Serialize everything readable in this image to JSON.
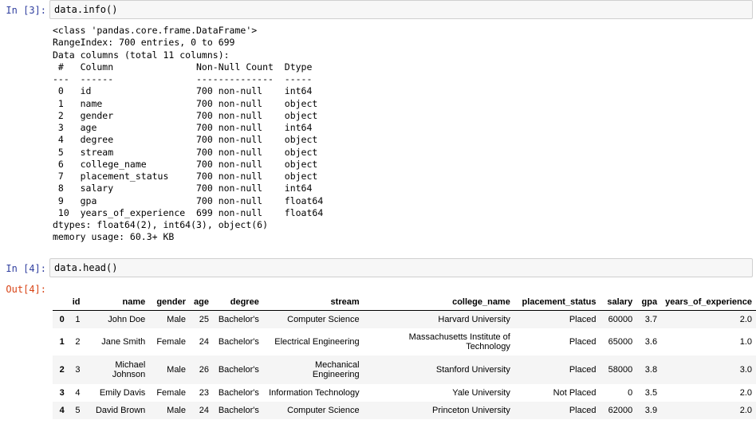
{
  "cells": [
    {
      "prompt": "In [3]:",
      "code": "data.info()"
    },
    {
      "prompt": "In [4]:",
      "code": "data.head()",
      "out_prompt": "Out[4]:"
    }
  ],
  "info_output": "<class 'pandas.core.frame.DataFrame'>\nRangeIndex: 700 entries, 0 to 699\nData columns (total 11 columns):\n #   Column               Non-Null Count  Dtype  \n---  ------               --------------  -----  \n 0   id                   700 non-null    int64  \n 1   name                 700 non-null    object \n 2   gender               700 non-null    object \n 3   age                  700 non-null    int64  \n 4   degree               700 non-null    object \n 5   stream               700 non-null    object \n 6   college_name         700 non-null    object \n 7   placement_status     700 non-null    object \n 8   salary               700 non-null    int64  \n 9   gpa                  700 non-null    float64\n 10  years_of_experience  699 non-null    float64\ndtypes: float64(2), int64(3), object(6)\nmemory usage: 60.3+ KB",
  "dataframe": {
    "columns": [
      "",
      "id",
      "name",
      "gender",
      "age",
      "degree",
      "stream",
      "college_name",
      "placement_status",
      "salary",
      "gpa",
      "years_of_experience"
    ],
    "rows": [
      {
        "index": "0",
        "id": "1",
        "name": "John Doe",
        "gender": "Male",
        "age": "25",
        "degree": "Bachelor's",
        "stream": "Computer Science",
        "college_name": "Harvard University",
        "placement_status": "Placed",
        "salary": "60000",
        "gpa": "3.7",
        "years_of_experience": "2.0"
      },
      {
        "index": "1",
        "id": "2",
        "name": "Jane Smith",
        "gender": "Female",
        "age": "24",
        "degree": "Bachelor's",
        "stream": "Electrical Engineering",
        "college_name": "Massachusetts Institute of Technology",
        "placement_status": "Placed",
        "salary": "65000",
        "gpa": "3.6",
        "years_of_experience": "1.0"
      },
      {
        "index": "2",
        "id": "3",
        "name": "Michael Johnson",
        "gender": "Male",
        "age": "26",
        "degree": "Bachelor's",
        "stream": "Mechanical Engineering",
        "college_name": "Stanford University",
        "placement_status": "Placed",
        "salary": "58000",
        "gpa": "3.8",
        "years_of_experience": "3.0"
      },
      {
        "index": "3",
        "id": "4",
        "name": "Emily Davis",
        "gender": "Female",
        "age": "23",
        "degree": "Bachelor's",
        "stream": "Information Technology",
        "college_name": "Yale University",
        "placement_status": "Not Placed",
        "salary": "0",
        "gpa": "3.5",
        "years_of_experience": "2.0"
      },
      {
        "index": "4",
        "id": "5",
        "name": "David Brown",
        "gender": "Male",
        "age": "24",
        "degree": "Bachelor's",
        "stream": "Computer Science",
        "college_name": "Princeton University",
        "placement_status": "Placed",
        "salary": "62000",
        "gpa": "3.9",
        "years_of_experience": "2.0"
      }
    ]
  },
  "colors": {
    "in_prompt": "#303f9f",
    "out_prompt": "#d84315",
    "input_bg": "#f7f7f7",
    "stripe": "#f5f5f5"
  }
}
